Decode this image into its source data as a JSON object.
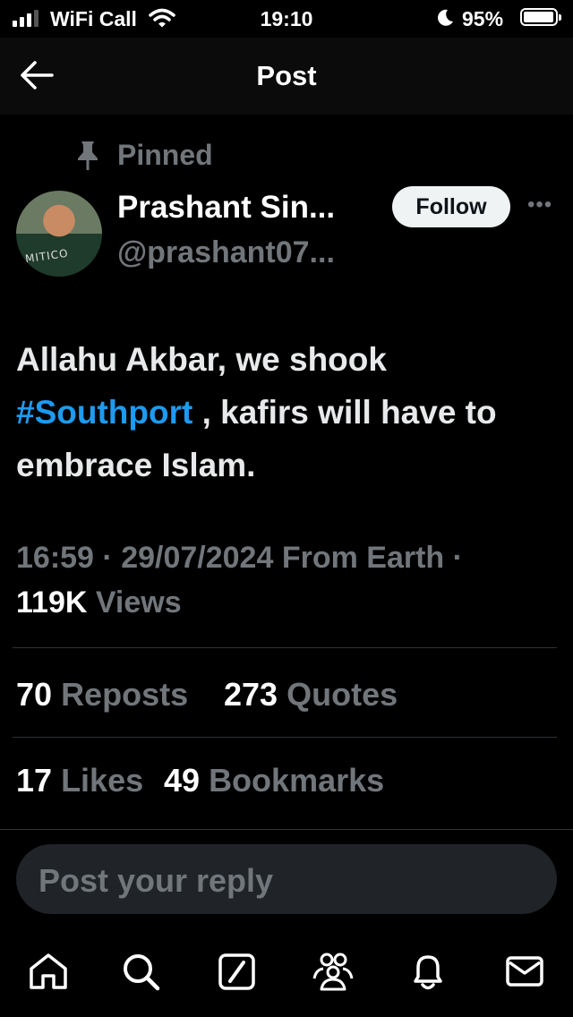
{
  "status_bar": {
    "carrier": "WiFi Call",
    "time": "19:10",
    "battery_percent": "95%",
    "battery_level": 0.95
  },
  "header": {
    "title": "Post",
    "back_icon": "arrow-left-icon"
  },
  "post": {
    "pinned_label": "Pinned",
    "author_name": "Prashant Sin...",
    "author_handle": "@prashant07...",
    "follow_label": "Follow",
    "more_icon": "ellipsis-icon",
    "text_before": "Allahu Akbar, we shook",
    "hashtag": "#Southport",
    "text_after": ", kafirs will have to embrace Islam.",
    "time": "16:59",
    "date": "29/07/2024",
    "source": "From Earth",
    "separator": "·",
    "views_count": "119K",
    "views_label": "Views",
    "reposts_count": "70",
    "reposts_label": "Reposts",
    "quotes_count": "273",
    "quotes_label": "Quotes",
    "likes_count": "17",
    "likes_label": "Likes",
    "bookmarks_count": "49",
    "bookmarks_label": "Bookmarks"
  },
  "reply": {
    "placeholder": "Post your reply"
  },
  "tab_bar": [
    {
      "icon": "home-icon"
    },
    {
      "icon": "search-icon"
    },
    {
      "icon": "grok-icon"
    },
    {
      "icon": "communities-icon"
    },
    {
      "icon": "notifications-icon"
    },
    {
      "icon": "messages-icon"
    }
  ],
  "colors": {
    "background": "#000000",
    "link": "#1d9bf0",
    "muted": "#71767b",
    "divider": "#2f3336"
  }
}
